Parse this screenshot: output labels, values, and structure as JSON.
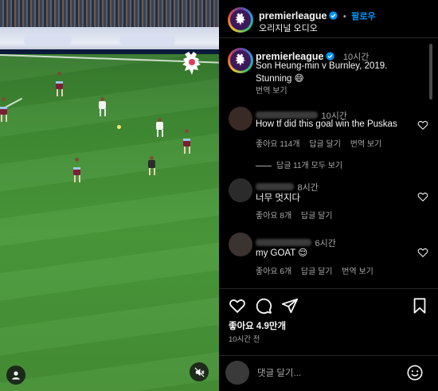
{
  "post": {
    "username": "premierleague",
    "follow_label": "팔로우",
    "audio_label": "오리지널 오디오"
  },
  "caption": {
    "username": "premierleague",
    "time": "10시간",
    "line1": "Son Heung-min v Burnley, 2019.",
    "line2": "Stunning 😄",
    "translate_label": "번역 보기"
  },
  "comments": [
    {
      "time": "10시간",
      "text": "How tf did this goal win the Puskas",
      "likes": "좋아요 114개",
      "reply_label": "답글 달기",
      "translate_label": "번역 보기",
      "view_replies": "답글 11개 모두 보기"
    },
    {
      "time": "8시간",
      "text": "너무 멋지다",
      "likes": "좋아요 8개",
      "reply_label": "답글 달기"
    },
    {
      "time": "6시간",
      "text": "my GOAT 😌",
      "likes": "좋아요 6개",
      "reply_label": "답글 달기",
      "translate_label": "번역 보기"
    }
  ],
  "stats": {
    "likes": "좋아요 4.9만개",
    "posted": "10시간 전"
  },
  "comment_input": {
    "placeholder": "댓글 달기..."
  },
  "icons": {
    "like": "heart-icon",
    "comment": "comment-bubble-icon",
    "share": "paper-plane-icon",
    "save": "bookmark-icon",
    "emoji": "smiley-icon",
    "user": "user-icon",
    "mute": "speaker-muted-icon"
  },
  "colors": {
    "accent": "#0095f6",
    "background": "#000000",
    "muted_text": "#a8a8a8",
    "divider": "#262626"
  }
}
